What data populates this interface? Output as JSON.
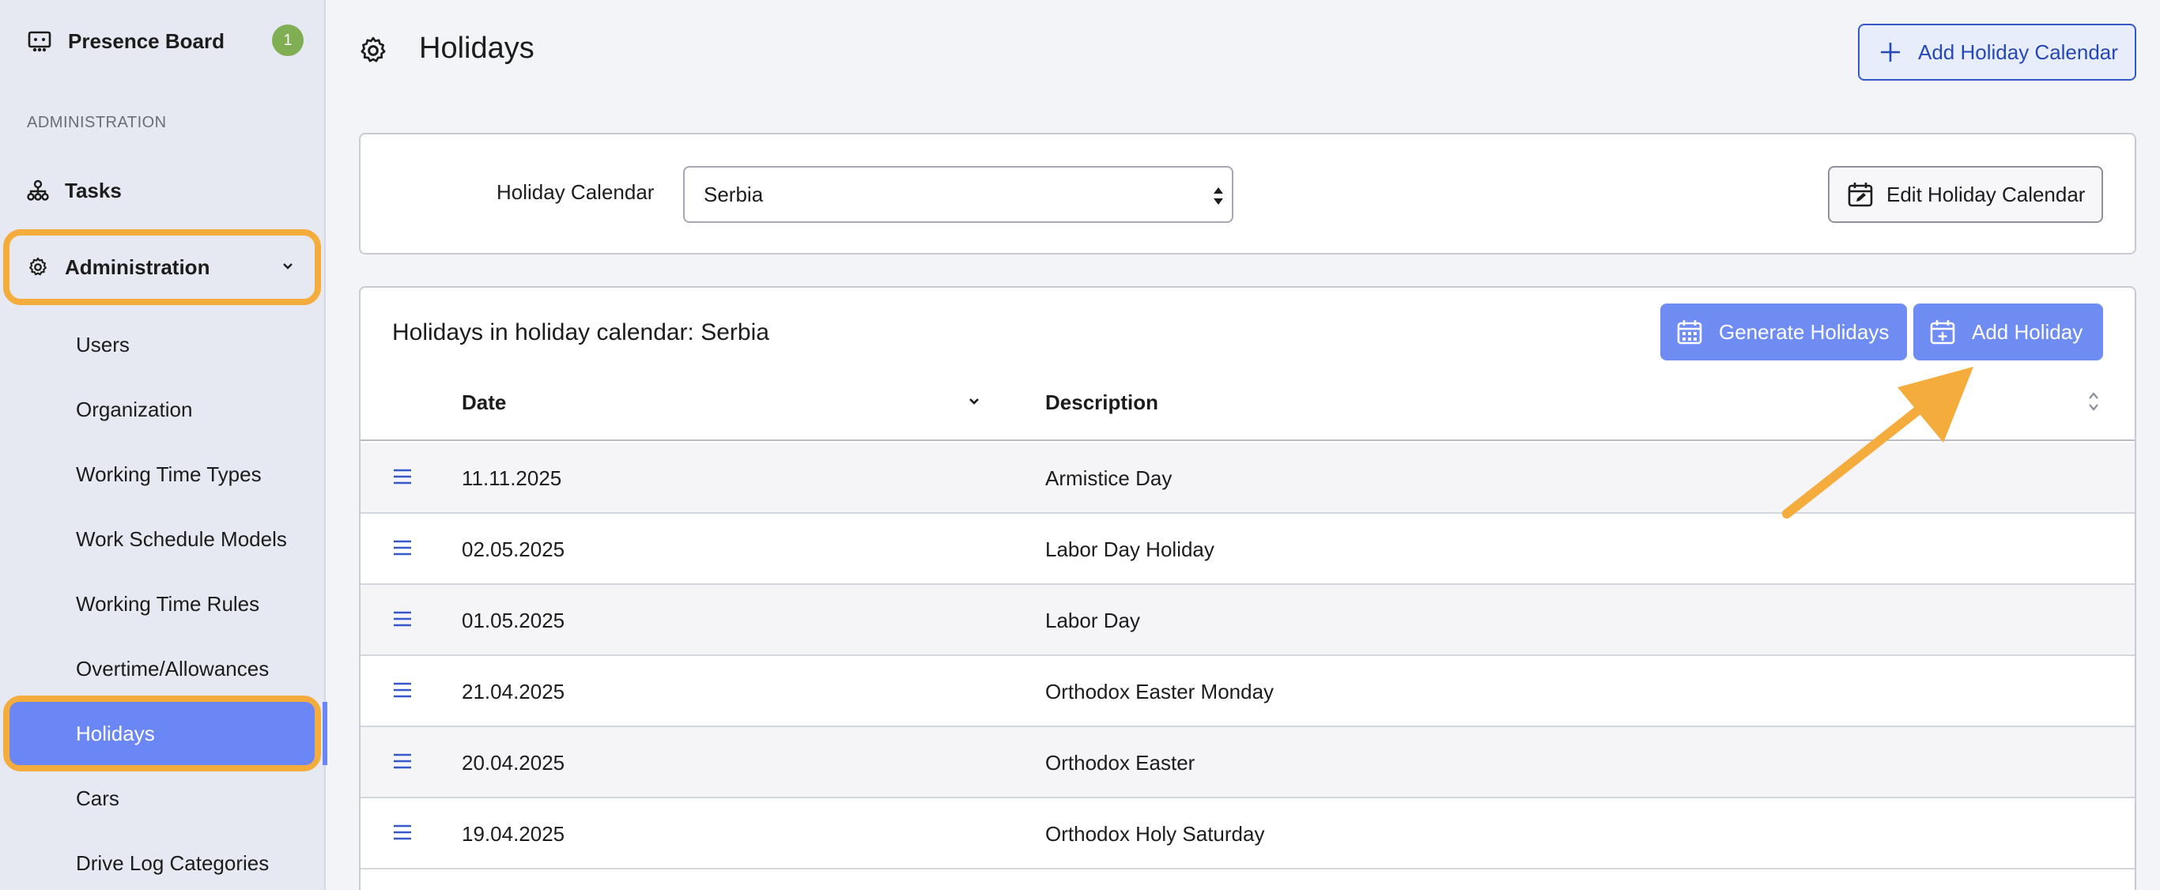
{
  "brand": {
    "name": "Presence Board",
    "badge": "1"
  },
  "sidebar": {
    "section_label": "ADMINISTRATION",
    "tasks_label": "Tasks",
    "administration_label": "Administration",
    "items": [
      {
        "label": "Users"
      },
      {
        "label": "Organization"
      },
      {
        "label": "Working Time Types"
      },
      {
        "label": "Work Schedule Models"
      },
      {
        "label": "Working Time Rules"
      },
      {
        "label": "Overtime/Allowances"
      },
      {
        "label": "Holidays",
        "active": true
      },
      {
        "label": "Cars"
      },
      {
        "label": "Drive Log Categories"
      }
    ]
  },
  "header": {
    "title": "Holidays",
    "add_calendar_label": "Add Holiday Calendar"
  },
  "filter": {
    "label": "Holiday Calendar",
    "selected": "Serbia",
    "edit_label": "Edit Holiday Calendar"
  },
  "table": {
    "title": "Holidays in holiday calendar: Serbia",
    "generate_label": "Generate Holidays",
    "add_label": "Add Holiday",
    "columns": {
      "date": "Date",
      "description": "Description"
    },
    "rows": [
      {
        "date": "11.11.2025",
        "description": "Armistice Day"
      },
      {
        "date": "02.05.2025",
        "description": "Labor Day Holiday"
      },
      {
        "date": "01.05.2025",
        "description": "Labor Day"
      },
      {
        "date": "21.04.2025",
        "description": "Orthodox Easter Monday"
      },
      {
        "date": "20.04.2025",
        "description": "Orthodox Easter"
      },
      {
        "date": "19.04.2025",
        "description": "Orthodox Holy Saturday"
      }
    ]
  },
  "colors": {
    "accent": "#6b87f5",
    "highlight": "#f4ad3d",
    "badge": "#7fae53",
    "primary_outline": "#3558c8"
  }
}
